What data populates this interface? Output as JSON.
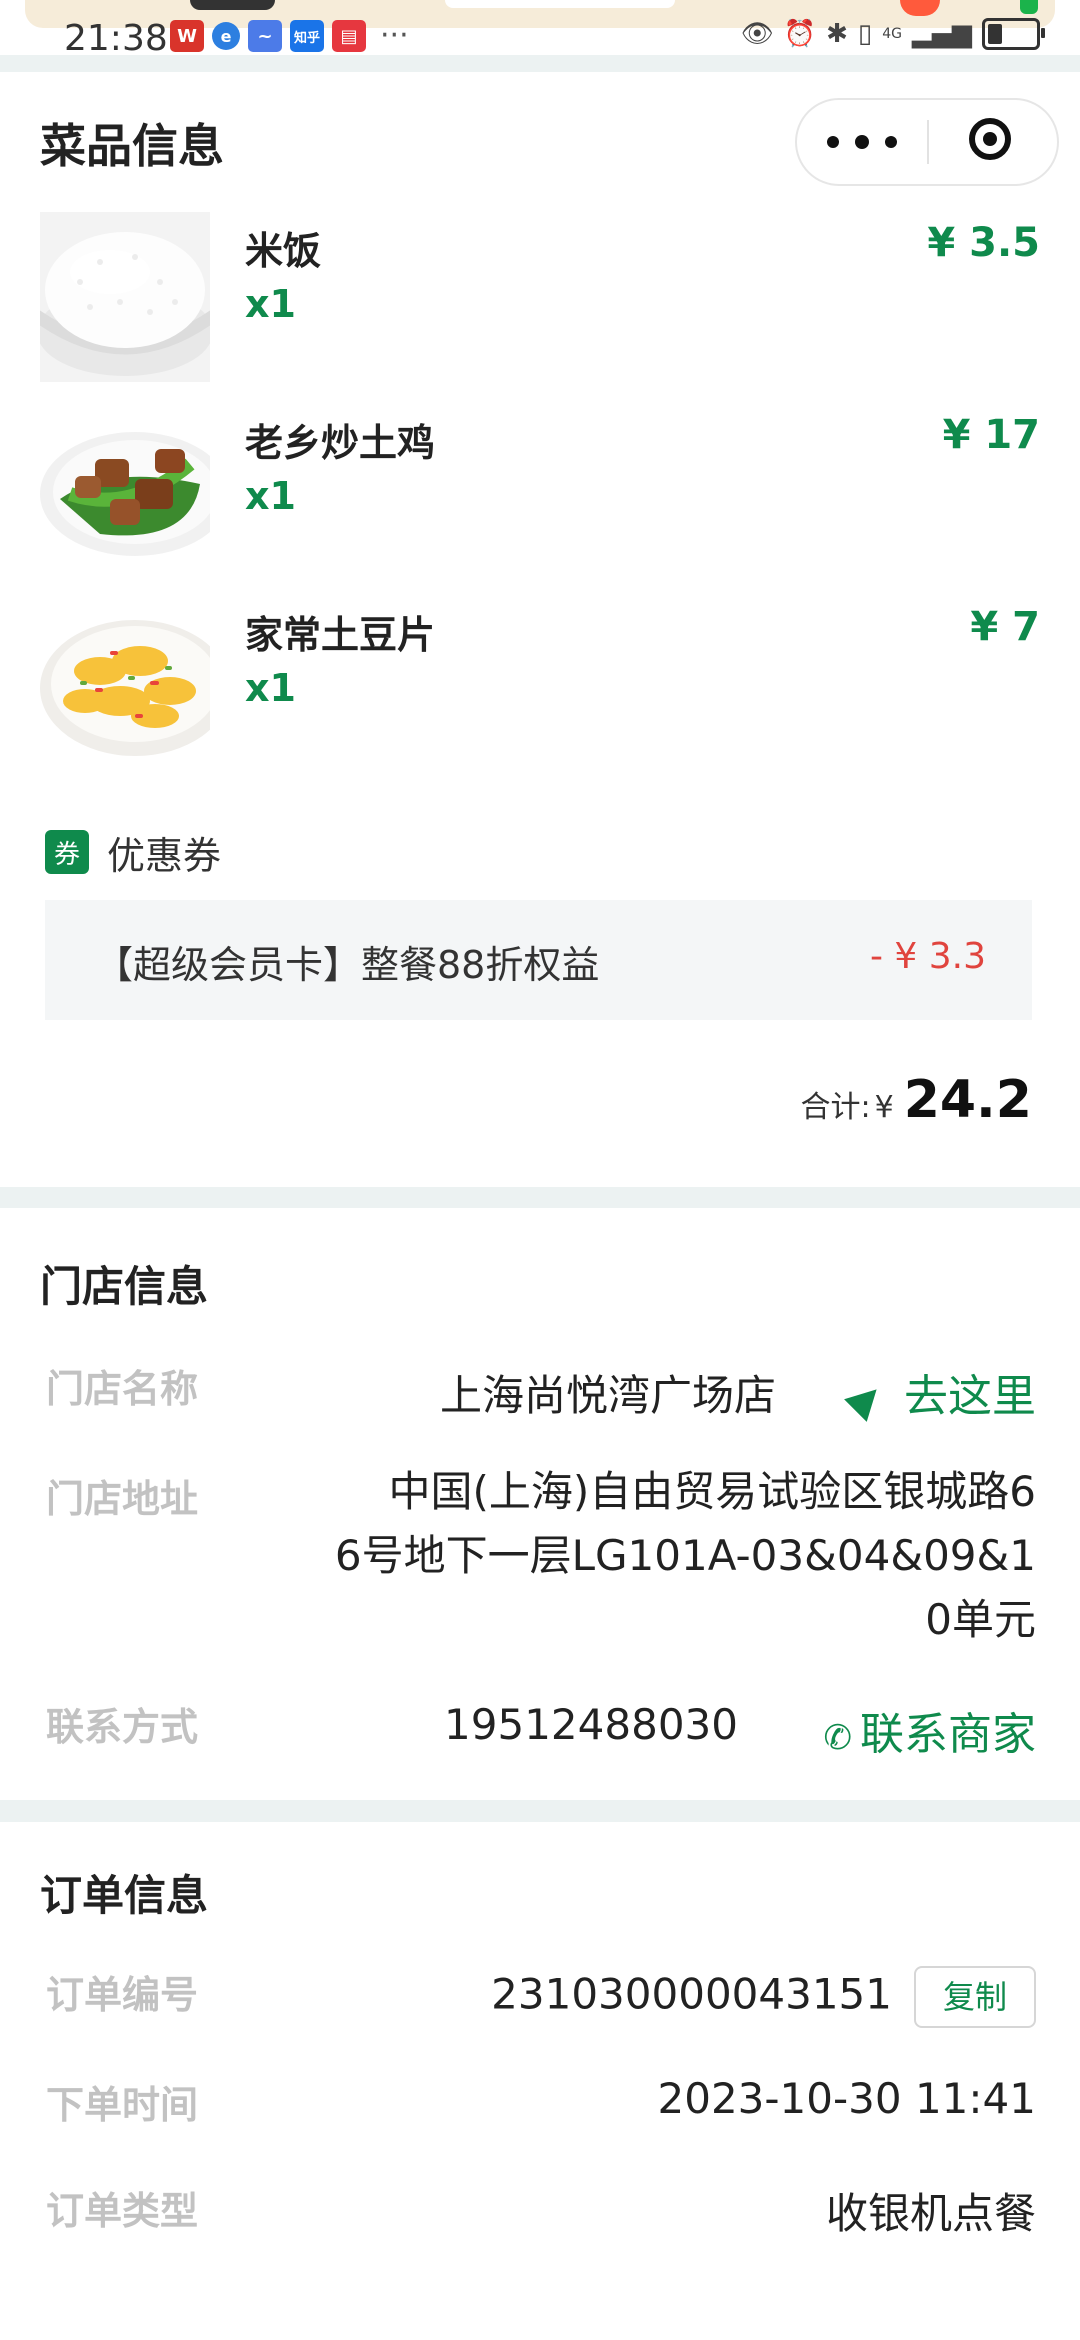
{
  "status_bar": {
    "time": "21:38",
    "apps": [
      {
        "name": "wps-icon",
        "glyph": "W",
        "color": "#d9342b"
      },
      {
        "name": "browser-icon",
        "glyph": "e",
        "color": "#2d7fe0"
      },
      {
        "name": "app-icon",
        "glyph": "~",
        "color": "#4c7be8"
      },
      {
        "name": "zhihu-icon",
        "glyph": "知乎",
        "color": "#1a74e8"
      },
      {
        "name": "reader-icon",
        "glyph": "▤",
        "color": "#e6373f"
      }
    ],
    "more": "···",
    "network": "4G"
  },
  "dishes_section": {
    "title": "菜品信息",
    "items": [
      {
        "name": "米饭",
        "qty": "x1",
        "price": "¥ 3.5"
      },
      {
        "name": "老乡炒土鸡",
        "qty": "x1",
        "price": "¥ 17"
      },
      {
        "name": "家常土豆片",
        "qty": "x1",
        "price": "¥ 7"
      }
    ],
    "coupon_tag": "券",
    "coupon_label": "优惠券",
    "coupon_desc": "【超级会员卡】整餐88折权益",
    "coupon_discount": "- ¥ 3.3",
    "total_label": "合计:",
    "total_currency": "¥",
    "total_amount": "24.2"
  },
  "store_section": {
    "title": "门店信息",
    "name_label": "门店名称",
    "name_value": "上海尚悦湾广场店",
    "goto_label": "去这里",
    "address_label": "门店地址",
    "address_lines": [
      "中国(上海)自由贸易试验区银城路6",
      "6号地下一层LG101A-03&04&09&1",
      "0单元"
    ],
    "contact_label": "联系方式",
    "contact_value": "19512488030",
    "contact_link": "联系商家"
  },
  "order_section": {
    "title": "订单信息",
    "number_label": "订单编号",
    "number_value": "231030000043151",
    "copy_label": "复制",
    "time_label": "下单时间",
    "time_value": "2023-10-30 11:41",
    "type_label": "订单类型",
    "type_value": "收银机点餐"
  },
  "colors": {
    "accent": "#0f8a4c",
    "discount": "#e0443e",
    "label_gray": "#c2c2c2",
    "page_bg": "#ecf2f2"
  }
}
